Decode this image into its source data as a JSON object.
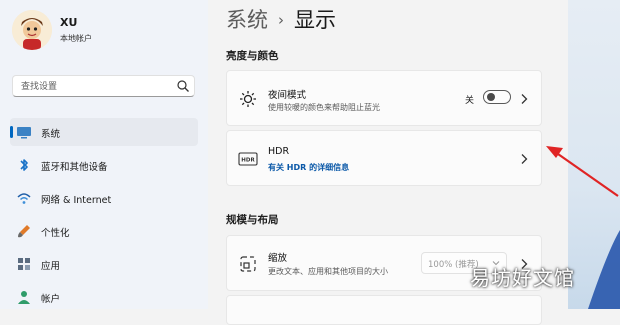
{
  "user": {
    "name": "XU",
    "account_type": "本地帐户"
  },
  "search": {
    "placeholder": "查找设置"
  },
  "nav": [
    {
      "label": "系统",
      "icon": "monitor-icon",
      "active": true
    },
    {
      "label": "蓝牙和其他设备",
      "icon": "bluetooth-icon",
      "active": false
    },
    {
      "label": "网络 & Internet",
      "icon": "wifi-icon",
      "active": false
    },
    {
      "label": "个性化",
      "icon": "brush-icon",
      "active": false
    },
    {
      "label": "应用",
      "icon": "apps-icon",
      "active": false
    },
    {
      "label": "帐户",
      "icon": "person-icon",
      "active": false
    }
  ],
  "header": {
    "crumb": "系统",
    "separator": "›",
    "title": "显示"
  },
  "sections": {
    "brightness": "亮度与颜色",
    "scale_layout": "规模与布局"
  },
  "night_light": {
    "title": "夜间模式",
    "subtitle": "使用较暖的颜色来帮助阻止蓝光",
    "toggle_label": "关"
  },
  "hdr": {
    "title": "HDR",
    "link": "有关 HDR 的详细信息"
  },
  "scale": {
    "title": "缩放",
    "subtitle": "更改文本、应用和其他项目的大小",
    "value": "100% (推荐)"
  },
  "watermark": "易坊好文馆",
  "colors": {
    "accent": "#0067c0",
    "arrow": "#e02424"
  }
}
